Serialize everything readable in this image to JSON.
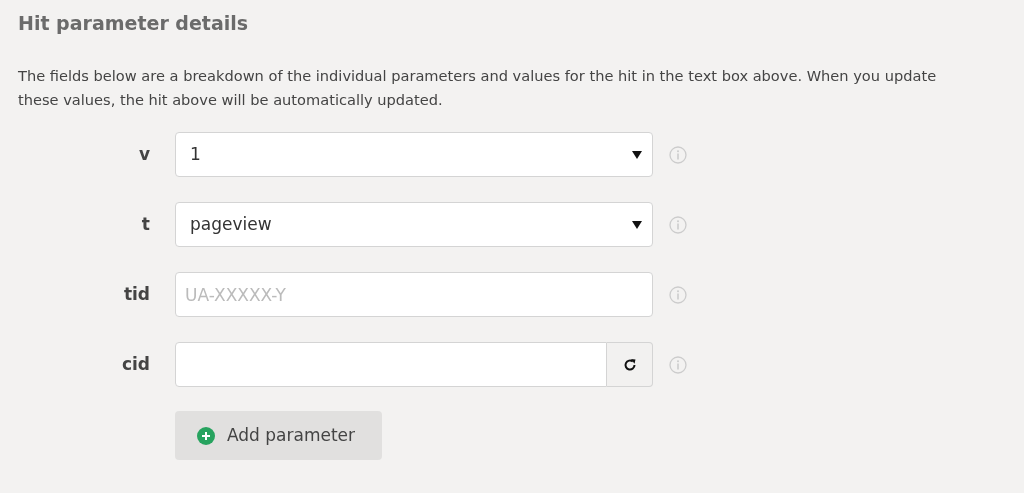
{
  "title": "Hit parameter details",
  "description": "The fields below are a breakdown of the individual parameters and values for the hit in the text box above. When you update these values, the hit above will be automatically updated.",
  "parameters": [
    {
      "label": "v",
      "kind": "select",
      "value": "1"
    },
    {
      "label": "t",
      "kind": "select",
      "value": "pageview"
    },
    {
      "label": "tid",
      "kind": "text",
      "placeholder": "UA-XXXXX-Y"
    },
    {
      "label": "cid",
      "kind": "refresh"
    }
  ],
  "add_button": "Add parameter"
}
